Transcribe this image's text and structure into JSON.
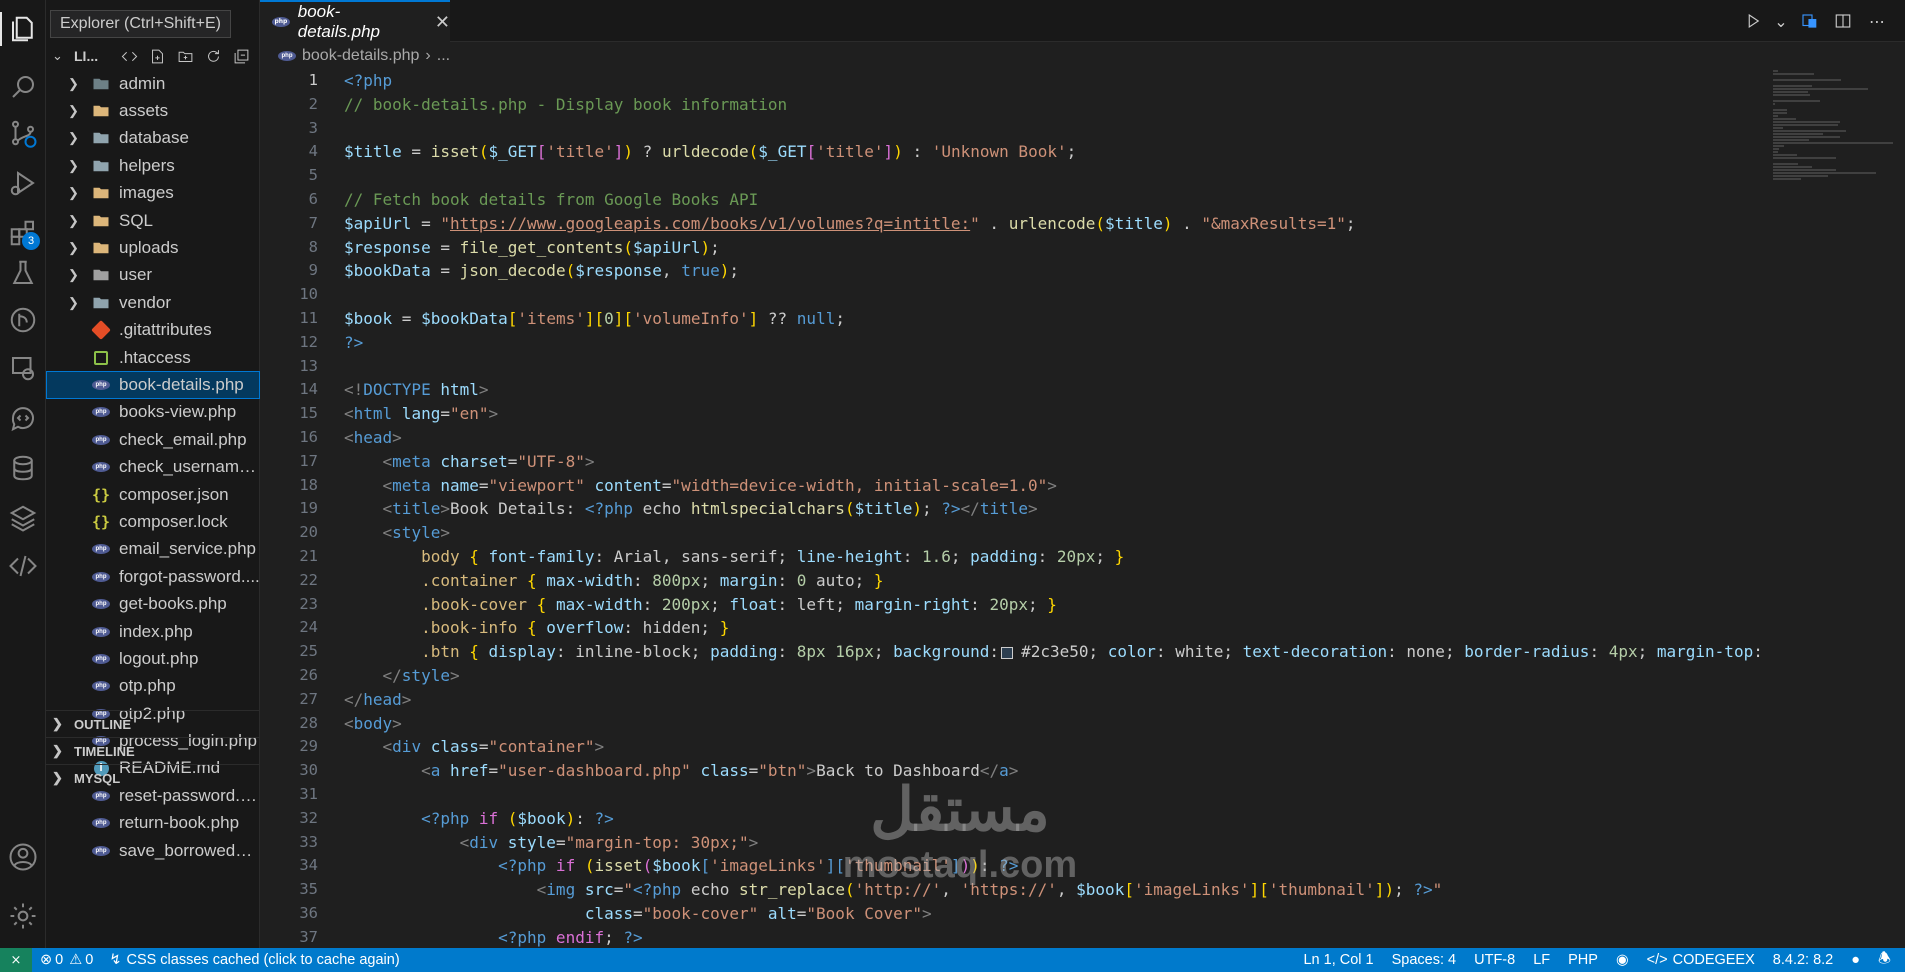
{
  "tooltip": "Explorer (Ctrl+Shift+E)",
  "activity_bar": {
    "extensions_badge": "3"
  },
  "explorer": {
    "project_label": "LI...",
    "items": [
      {
        "label": "admin",
        "kind": "folder",
        "icon": "folder-gear-icon"
      },
      {
        "label": "assets",
        "kind": "folder",
        "icon": "folder-icon"
      },
      {
        "label": "database",
        "kind": "folder",
        "icon": "folder-icon"
      },
      {
        "label": "helpers",
        "kind": "folder",
        "icon": "folder-icon"
      },
      {
        "label": "images",
        "kind": "folder",
        "icon": "folder-icon"
      },
      {
        "label": "SQL",
        "kind": "folder",
        "icon": "folder-icon"
      },
      {
        "label": "uploads",
        "kind": "folder",
        "icon": "folder-icon"
      },
      {
        "label": "user",
        "kind": "folder",
        "icon": "folder-icon"
      },
      {
        "label": "vendor",
        "kind": "folder",
        "icon": "folder-icon"
      },
      {
        "label": ".gitattributes",
        "kind": "file",
        "icon": "git-icon"
      },
      {
        "label": ".htaccess",
        "kind": "file",
        "icon": "htaccess-icon"
      },
      {
        "label": "book-details.php",
        "kind": "file",
        "icon": "php-icon",
        "selected": true
      },
      {
        "label": "books-view.php",
        "kind": "file",
        "icon": "php-icon"
      },
      {
        "label": "check_email.php",
        "kind": "file",
        "icon": "php-icon"
      },
      {
        "label": "check_username....",
        "kind": "file",
        "icon": "php-icon"
      },
      {
        "label": "composer.json",
        "kind": "file",
        "icon": "json-icon"
      },
      {
        "label": "composer.lock",
        "kind": "file",
        "icon": "json-icon"
      },
      {
        "label": "email_service.php",
        "kind": "file",
        "icon": "php-icon"
      },
      {
        "label": "forgot-password....",
        "kind": "file",
        "icon": "php-icon"
      },
      {
        "label": "get-books.php",
        "kind": "file",
        "icon": "php-icon"
      },
      {
        "label": "index.php",
        "kind": "file",
        "icon": "php-icon"
      },
      {
        "label": "logout.php",
        "kind": "file",
        "icon": "php-icon"
      },
      {
        "label": "otp.php",
        "kind": "file",
        "icon": "php-icon"
      },
      {
        "label": "otp2.php",
        "kind": "file",
        "icon": "php-icon"
      },
      {
        "label": "process_login.php",
        "kind": "file",
        "icon": "php-icon"
      },
      {
        "label": "README.md",
        "kind": "file",
        "icon": "info-icon"
      },
      {
        "label": "reset-password.php",
        "kind": "file",
        "icon": "php-icon"
      },
      {
        "label": "return-book.php",
        "kind": "file",
        "icon": "php-icon"
      },
      {
        "label": "save_borrowed_b...",
        "kind": "file",
        "icon": "php-icon"
      }
    ],
    "sections": [
      "OUTLINE",
      "TIMELINE",
      "MYSQL"
    ]
  },
  "editor": {
    "tab_label": "book-details.php",
    "breadcrumb_file": "book-details.php",
    "breadcrumb_more": "...",
    "current_line": 1,
    "lines": [
      [
        [
          "<?php",
          "k"
        ]
      ],
      [
        [
          "// book-details.php - Display book information",
          "c"
        ]
      ],
      [],
      [
        [
          "$title",
          "v"
        ],
        [
          " = ",
          "pl"
        ],
        [
          "isset",
          "f"
        ],
        [
          "(",
          "y"
        ],
        [
          "$_GET",
          "v"
        ],
        [
          "[",
          "p"
        ],
        [
          "'title'",
          "s"
        ],
        [
          "]",
          "p"
        ],
        [
          ")",
          "y"
        ],
        [
          " ? ",
          "pl"
        ],
        [
          "urldecode",
          "f"
        ],
        [
          "(",
          "y"
        ],
        [
          "$_GET",
          "v"
        ],
        [
          "[",
          "p"
        ],
        [
          "'title'",
          "s"
        ],
        [
          "]",
          "p"
        ],
        [
          ")",
          "y"
        ],
        [
          " : ",
          "pl"
        ],
        [
          "'Unknown Book'",
          "s"
        ],
        [
          ";",
          "pl"
        ]
      ],
      [],
      [
        [
          "// Fetch book details from Google Books API",
          "c"
        ]
      ],
      [
        [
          "$apiUrl",
          "v"
        ],
        [
          " = ",
          "pl"
        ],
        [
          "\"",
          "s"
        ],
        [
          "https://www.googleapis.com/books/v1/volumes?q=intitle:",
          "su"
        ],
        [
          "\"",
          "s"
        ],
        [
          " . ",
          "pl"
        ],
        [
          "urlencode",
          "f"
        ],
        [
          "(",
          "y"
        ],
        [
          "$title",
          "v"
        ],
        [
          ")",
          "y"
        ],
        [
          " . ",
          "pl"
        ],
        [
          "\"&maxResults=1\"",
          "s"
        ],
        [
          ";",
          "pl"
        ]
      ],
      [
        [
          "$response",
          "v"
        ],
        [
          " = ",
          "pl"
        ],
        [
          "file_get_contents",
          "f"
        ],
        [
          "(",
          "y"
        ],
        [
          "$apiUrl",
          "v"
        ],
        [
          ")",
          "y"
        ],
        [
          ";",
          "pl"
        ]
      ],
      [
        [
          "$bookData",
          "v"
        ],
        [
          " = ",
          "pl"
        ],
        [
          "json_decode",
          "f"
        ],
        [
          "(",
          "y"
        ],
        [
          "$response",
          "v"
        ],
        [
          ", ",
          "pl"
        ],
        [
          "true",
          "k"
        ],
        [
          ")",
          "y"
        ],
        [
          ";",
          "pl"
        ]
      ],
      [],
      [
        [
          "$book",
          "v"
        ],
        [
          " = ",
          "pl"
        ],
        [
          "$bookData",
          "v"
        ],
        [
          "[",
          "y"
        ],
        [
          "'items'",
          "s"
        ],
        [
          "][",
          "y"
        ],
        [
          "0",
          "n"
        ],
        [
          "][",
          "y"
        ],
        [
          "'volumeInfo'",
          "s"
        ],
        [
          "]",
          "y"
        ],
        [
          " ?? ",
          "pl"
        ],
        [
          "null",
          "k"
        ],
        [
          ";",
          "pl"
        ]
      ],
      [
        [
          "?>",
          "k"
        ]
      ],
      [],
      [
        [
          "<!",
          "g"
        ],
        [
          "DOCTYPE",
          "k"
        ],
        [
          " html",
          "v"
        ],
        [
          ">",
          "g"
        ]
      ],
      [
        [
          "<",
          "g"
        ],
        [
          "html",
          "k"
        ],
        [
          " lang",
          "v"
        ],
        [
          "=",
          "pl"
        ],
        [
          "\"en\"",
          "s"
        ],
        [
          ">",
          "g"
        ]
      ],
      [
        [
          "<",
          "g"
        ],
        [
          "head",
          "k"
        ],
        [
          ">",
          "g"
        ]
      ],
      [
        [
          "    ",
          "pl"
        ],
        [
          "<",
          "g"
        ],
        [
          "meta",
          "k"
        ],
        [
          " charset",
          "v"
        ],
        [
          "=",
          "pl"
        ],
        [
          "\"UTF-8\"",
          "s"
        ],
        [
          ">",
          "g"
        ]
      ],
      [
        [
          "    ",
          "pl"
        ],
        [
          "<",
          "g"
        ],
        [
          "meta",
          "k"
        ],
        [
          " name",
          "v"
        ],
        [
          "=",
          "pl"
        ],
        [
          "\"viewport\"",
          "s"
        ],
        [
          " content",
          "v"
        ],
        [
          "=",
          "pl"
        ],
        [
          "\"width=device-width, initial-scale=1.0\"",
          "s"
        ],
        [
          ">",
          "g"
        ]
      ],
      [
        [
          "    ",
          "pl"
        ],
        [
          "<",
          "g"
        ],
        [
          "title",
          "k"
        ],
        [
          ">",
          "g"
        ],
        [
          "Book Details: ",
          "pl"
        ],
        [
          "<?php",
          "k"
        ],
        [
          " echo ",
          "pl"
        ],
        [
          "htmlspecialchars",
          "f"
        ],
        [
          "(",
          "y"
        ],
        [
          "$title",
          "v"
        ],
        [
          ")",
          "y"
        ],
        [
          "; ",
          "pl"
        ],
        [
          "?>",
          "k"
        ],
        [
          "</",
          "g"
        ],
        [
          "title",
          "k"
        ],
        [
          ">",
          "g"
        ]
      ],
      [
        [
          "    ",
          "pl"
        ],
        [
          "<",
          "g"
        ],
        [
          "style",
          "k"
        ],
        [
          ">",
          "g"
        ]
      ],
      [
        [
          "        ",
          "pl"
        ],
        [
          "body",
          "cls"
        ],
        [
          " { ",
          "y"
        ],
        [
          "font-family",
          "v"
        ],
        [
          ": Arial, sans-serif; ",
          "pl"
        ],
        [
          "line-height",
          "v"
        ],
        [
          ": ",
          "pl"
        ],
        [
          "1.6",
          "n"
        ],
        [
          "; ",
          "pl"
        ],
        [
          "padding",
          "v"
        ],
        [
          ": ",
          "pl"
        ],
        [
          "20px",
          "n"
        ],
        [
          "; ",
          "pl"
        ],
        [
          "}",
          "y"
        ]
      ],
      [
        [
          "        ",
          "pl"
        ],
        [
          ".container",
          "cls"
        ],
        [
          " { ",
          "y"
        ],
        [
          "max-width",
          "v"
        ],
        [
          ": ",
          "pl"
        ],
        [
          "800px",
          "n"
        ],
        [
          "; ",
          "pl"
        ],
        [
          "margin",
          "v"
        ],
        [
          ": ",
          "pl"
        ],
        [
          "0",
          "n"
        ],
        [
          " auto; ",
          "pl"
        ],
        [
          "}",
          "y"
        ]
      ],
      [
        [
          "        ",
          "pl"
        ],
        [
          ".book-cover",
          "cls"
        ],
        [
          " { ",
          "y"
        ],
        [
          "max-width",
          "v"
        ],
        [
          ": ",
          "pl"
        ],
        [
          "200px",
          "n"
        ],
        [
          "; ",
          "pl"
        ],
        [
          "float",
          "v"
        ],
        [
          ": left; ",
          "pl"
        ],
        [
          "margin-right",
          "v"
        ],
        [
          ": ",
          "pl"
        ],
        [
          "20px",
          "n"
        ],
        [
          "; ",
          "pl"
        ],
        [
          "}",
          "y"
        ]
      ],
      [
        [
          "        ",
          "pl"
        ],
        [
          ".book-info",
          "cls"
        ],
        [
          " { ",
          "y"
        ],
        [
          "overflow",
          "v"
        ],
        [
          ": hidden; ",
          "pl"
        ],
        [
          "}",
          "y"
        ]
      ],
      [
        [
          "        ",
          "pl"
        ],
        [
          ".btn",
          "cls"
        ],
        [
          " { ",
          "y"
        ],
        [
          "display",
          "v"
        ],
        [
          ": inline-block; ",
          "pl"
        ],
        [
          "padding",
          "v"
        ],
        [
          ": ",
          "pl"
        ],
        [
          "8px 16px",
          "n"
        ],
        [
          "; ",
          "pl"
        ],
        [
          "background",
          "v"
        ],
        [
          ":",
          "pl"
        ],
        [
          "SWATCH",
          "sw"
        ],
        [
          "#2c3e50; ",
          "pl"
        ],
        [
          "color",
          "v"
        ],
        [
          ": white; ",
          "pl"
        ],
        [
          "text-decoration",
          "v"
        ],
        [
          ": none; ",
          "pl"
        ],
        [
          "border-radius",
          "v"
        ],
        [
          ": ",
          "pl"
        ],
        [
          "4px",
          "n"
        ],
        [
          "; ",
          "pl"
        ],
        [
          "margin-top",
          "v"
        ],
        [
          ":",
          "pl"
        ]
      ],
      [
        [
          "    ",
          "pl"
        ],
        [
          "</",
          "g"
        ],
        [
          "style",
          "k"
        ],
        [
          ">",
          "g"
        ]
      ],
      [
        [
          "</",
          "g"
        ],
        [
          "head",
          "k"
        ],
        [
          ">",
          "g"
        ]
      ],
      [
        [
          "<",
          "g"
        ],
        [
          "body",
          "k"
        ],
        [
          ">",
          "g"
        ]
      ],
      [
        [
          "    ",
          "pl"
        ],
        [
          "<",
          "g"
        ],
        [
          "div",
          "k"
        ],
        [
          " class",
          "v"
        ],
        [
          "=",
          "pl"
        ],
        [
          "\"container\"",
          "s"
        ],
        [
          ">",
          "g"
        ]
      ],
      [
        [
          "        ",
          "pl"
        ],
        [
          "<",
          "g"
        ],
        [
          "a",
          "k"
        ],
        [
          " href",
          "v"
        ],
        [
          "=",
          "pl"
        ],
        [
          "\"user-dashboard.php\"",
          "s"
        ],
        [
          " class",
          "v"
        ],
        [
          "=",
          "pl"
        ],
        [
          "\"btn\"",
          "s"
        ],
        [
          ">",
          "g"
        ],
        [
          "Back to Dashboard",
          "pl"
        ],
        [
          "</",
          "g"
        ],
        [
          "a",
          "k"
        ],
        [
          ">",
          "g"
        ]
      ],
      [],
      [
        [
          "        ",
          "pl"
        ],
        [
          "<?php",
          "k"
        ],
        [
          " if ",
          "p"
        ],
        [
          "(",
          "y"
        ],
        [
          "$book",
          "v"
        ],
        [
          ")",
          "y"
        ],
        [
          ": ",
          "pl"
        ],
        [
          "?>",
          "k"
        ]
      ],
      [
        [
          "            ",
          "pl"
        ],
        [
          "<",
          "g"
        ],
        [
          "div",
          "k"
        ],
        [
          " style",
          "v"
        ],
        [
          "=",
          "pl"
        ],
        [
          "\"margin-top: 30px;\"",
          "s"
        ],
        [
          ">",
          "g"
        ]
      ],
      [
        [
          "                ",
          "pl"
        ],
        [
          "<?php",
          "k"
        ],
        [
          " if ",
          "p"
        ],
        [
          "(",
          "y"
        ],
        [
          "isset",
          "f"
        ],
        [
          "(",
          "p"
        ],
        [
          "$book",
          "v"
        ],
        [
          "[",
          "k"
        ],
        [
          "'imageLinks'",
          "s"
        ],
        [
          "][",
          "k"
        ],
        [
          "'thumbnail'",
          "s"
        ],
        [
          "]",
          "k"
        ],
        [
          ")",
          "p"
        ],
        [
          ")",
          "y"
        ],
        [
          ": ",
          "pl"
        ],
        [
          "?>",
          "k"
        ]
      ],
      [
        [
          "                    ",
          "pl"
        ],
        [
          "<",
          "g"
        ],
        [
          "img",
          "k"
        ],
        [
          " src",
          "v"
        ],
        [
          "=",
          "pl"
        ],
        [
          "\"",
          "s"
        ],
        [
          "<?php",
          "k"
        ],
        [
          " echo ",
          "pl"
        ],
        [
          "str_replace",
          "f"
        ],
        [
          "(",
          "y"
        ],
        [
          "'http://'",
          "s"
        ],
        [
          ", ",
          "pl"
        ],
        [
          "'https://'",
          "s"
        ],
        [
          ", ",
          "pl"
        ],
        [
          "$book",
          "v"
        ],
        [
          "[",
          "y"
        ],
        [
          "'imageLinks'",
          "s"
        ],
        [
          "][",
          "y"
        ],
        [
          "'thumbnail'",
          "s"
        ],
        [
          "]",
          "y"
        ],
        [
          ")",
          "y"
        ],
        [
          "; ",
          "pl"
        ],
        [
          "?>",
          "k"
        ],
        [
          "\"",
          "s"
        ]
      ],
      [
        [
          "                         ",
          "pl"
        ],
        [
          "class",
          "v"
        ],
        [
          "=",
          "pl"
        ],
        [
          "\"book-cover\"",
          "s"
        ],
        [
          " alt",
          "v"
        ],
        [
          "=",
          "pl"
        ],
        [
          "\"Book Cover\"",
          "s"
        ],
        [
          ">",
          "g"
        ]
      ],
      [
        [
          "                ",
          "pl"
        ],
        [
          "<?php",
          "k"
        ],
        [
          " endif",
          "p"
        ],
        [
          "; ",
          "pl"
        ],
        [
          "?>",
          "k"
        ]
      ]
    ]
  },
  "watermark": {
    "arabic": "مستقل",
    "latin": "mostaql.com"
  },
  "status_bar": {
    "problems_errors": "0",
    "problems_warnings": "0",
    "css_cache": "CSS classes cached (click to cache again)",
    "cursor": "Ln 1, Col 1",
    "spaces": "Spaces: 4",
    "encoding": "UTF-8",
    "eol": "LF",
    "language": "PHP",
    "codegeex": "CODEGEEX",
    "php_version": "8.4.2: 8.2"
  }
}
